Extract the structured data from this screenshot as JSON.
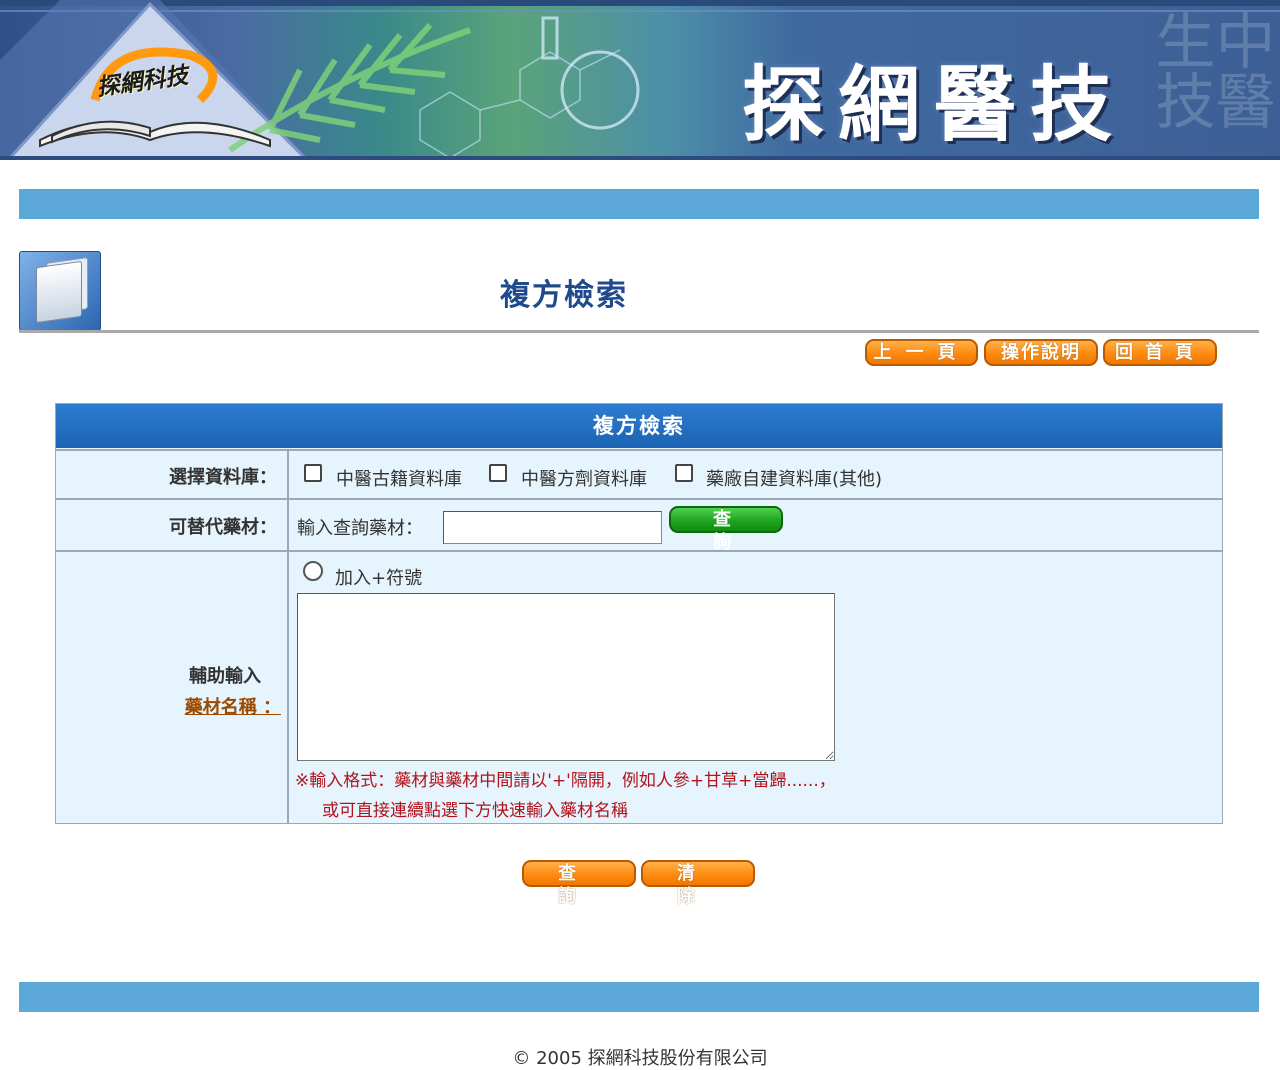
{
  "banner": {
    "logo_text": "探網科技",
    "title": "探網醫技",
    "ghost_text": "中醫生技"
  },
  "page": {
    "title": "複方檢索"
  },
  "nav": {
    "prev_label": "上一頁",
    "help_label": "操作說明",
    "home_label": "回首頁"
  },
  "form": {
    "header": "複方檢索",
    "database": {
      "label": "選擇資料庫：",
      "options": [
        "中醫古籍資料庫",
        "中醫方劑資料庫",
        "藥廠自建資料庫(其他)"
      ]
    },
    "substitute": {
      "label": "可替代藥材：",
      "input_label": "輸入查詢藥材：",
      "input_value": "",
      "button_label": "查詢"
    },
    "assist": {
      "label_line1": "輔助輸入",
      "label_line2": "藥材名稱 ：",
      "radio_label": "加入+符號",
      "textarea_value": "",
      "hint_line1": "※輸入格式：藥材與藥材中間請以'+'隔開，例如人參+甘草+當歸......，",
      "hint_line2": "或可直接連續點選下方快速輸入藥材名稱"
    }
  },
  "actions": {
    "search_label": "查詢",
    "clear_label": "清除"
  },
  "footer": {
    "copyright": "© 2005 探網科技股份有限公司"
  },
  "colors": {
    "accent_blue": "#5ca8d8",
    "header_blue": "#1b63b4",
    "button_orange": "#ff8a10",
    "button_green": "#1fa51f",
    "hint_red": "#b3121c",
    "link_brown": "#9b4a00"
  }
}
